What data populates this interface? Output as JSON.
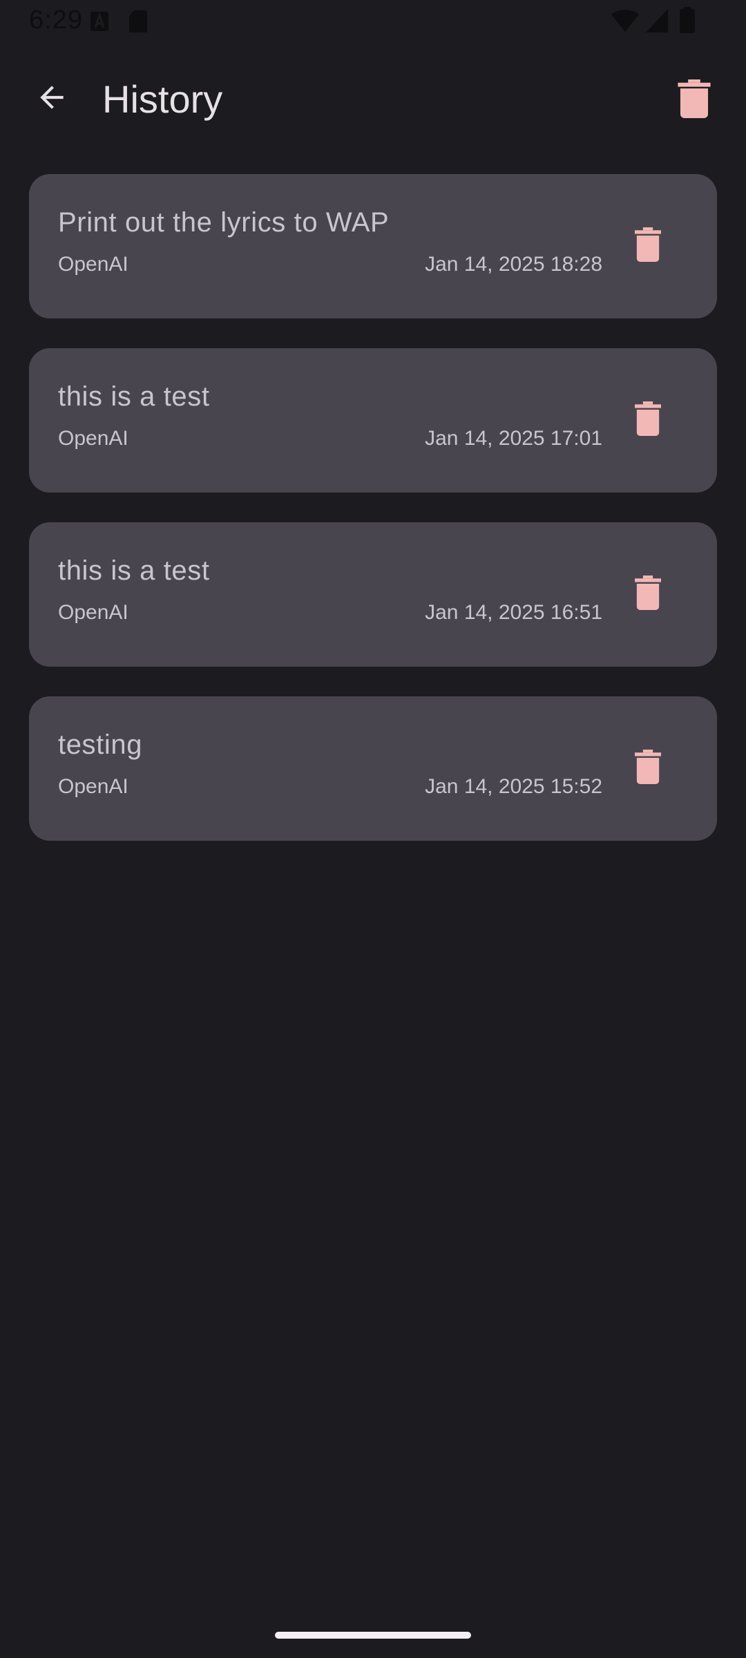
{
  "status_bar": {
    "time": "6:29"
  },
  "app_bar": {
    "title": "History",
    "back_icon": "arrow-back-icon",
    "clear_icon": "trash-icon"
  },
  "colors": {
    "background": "#1c1b1f",
    "card": "#49454f",
    "text_primary": "#e6e1e5",
    "text_secondary": "#cac4d0",
    "accent_delete": "#f2b8b5"
  },
  "history": [
    {
      "title": "Print out the lyrics to WAP",
      "provider": "OpenAI",
      "date": "Jan 14, 2025 18:28"
    },
    {
      "title": "this is a test",
      "provider": "OpenAI",
      "date": "Jan 14, 2025 17:01"
    },
    {
      "title": "this is a test",
      "provider": "OpenAI",
      "date": "Jan 14, 2025 16:51"
    },
    {
      "title": "testing",
      "provider": "OpenAI",
      "date": "Jan 14, 2025 15:52"
    }
  ]
}
